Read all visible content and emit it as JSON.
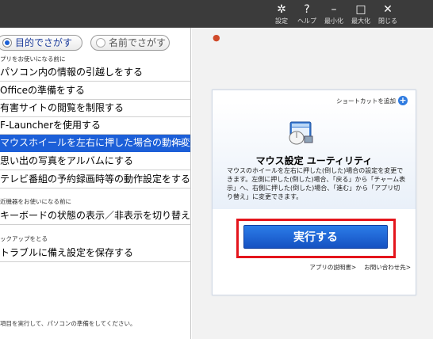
{
  "window": {
    "controls": [
      {
        "name": "settings-button",
        "icon": "gear-icon",
        "glyph": "✲",
        "label": "設定"
      },
      {
        "name": "help-button",
        "icon": "question-icon",
        "glyph": "?",
        "label": "ヘルプ"
      },
      {
        "name": "minimize-button",
        "icon": "minimize-icon",
        "glyph": "–",
        "label": "最小化"
      },
      {
        "name": "maximize-button",
        "icon": "maximize-icon",
        "glyph": "□",
        "label": "最大化"
      },
      {
        "name": "close-button",
        "icon": "close-icon",
        "glyph": "✕",
        "label": "閉じる"
      }
    ]
  },
  "search": {
    "purpose_label": "目的でさがす",
    "name_label": "名前でさがす"
  },
  "sections": [
    {
      "header": "プリをお使いになる前に",
      "items": [
        "パソコン内の情報の引越しをする",
        "Officeの準備をする",
        "有害サイトの閲覧を制限する",
        "F-Launcherを使用する",
        "マウスホイールを左右に押した場合の動作変更",
        "思い出の写真をアルバムにする",
        "テレビ番組の予約録画時等の動作設定をする"
      ]
    },
    {
      "header": "近機器をお使いになる前に",
      "items": [
        "キーボードの状態の表示／非表示を切り替える"
      ]
    },
    {
      "header": "ックアップをとる",
      "items": [
        "トラブルに備え設定を保存する"
      ]
    }
  ],
  "selected_item_arrow": ">>",
  "footnote": "項目を実行して、パソコンの準備をしてください。",
  "detail": {
    "shortcut_label": "ショートカットを追加",
    "app_icon": "mouse-settings-app-icon",
    "title": "マウス設定 ユーティリティ",
    "description": "マウスのホイールを左右に押した(倒した)場合の設定を変更できます。左側に押した(倒した)場合、「戻る」から「チャーム表示」へ、右側に押した(倒した)場合、「進む」から「アプリ切り替え」に変更できます。",
    "run_label": "実行する",
    "manual_link": "アプリの説明書>",
    "contact_link": "お問い合わせ先>"
  },
  "colors": {
    "titlebar": "#3b3b3b",
    "selection": "#1c5fd8",
    "run_button": "#1e66dc",
    "highlight_frame": "#e4151c"
  }
}
